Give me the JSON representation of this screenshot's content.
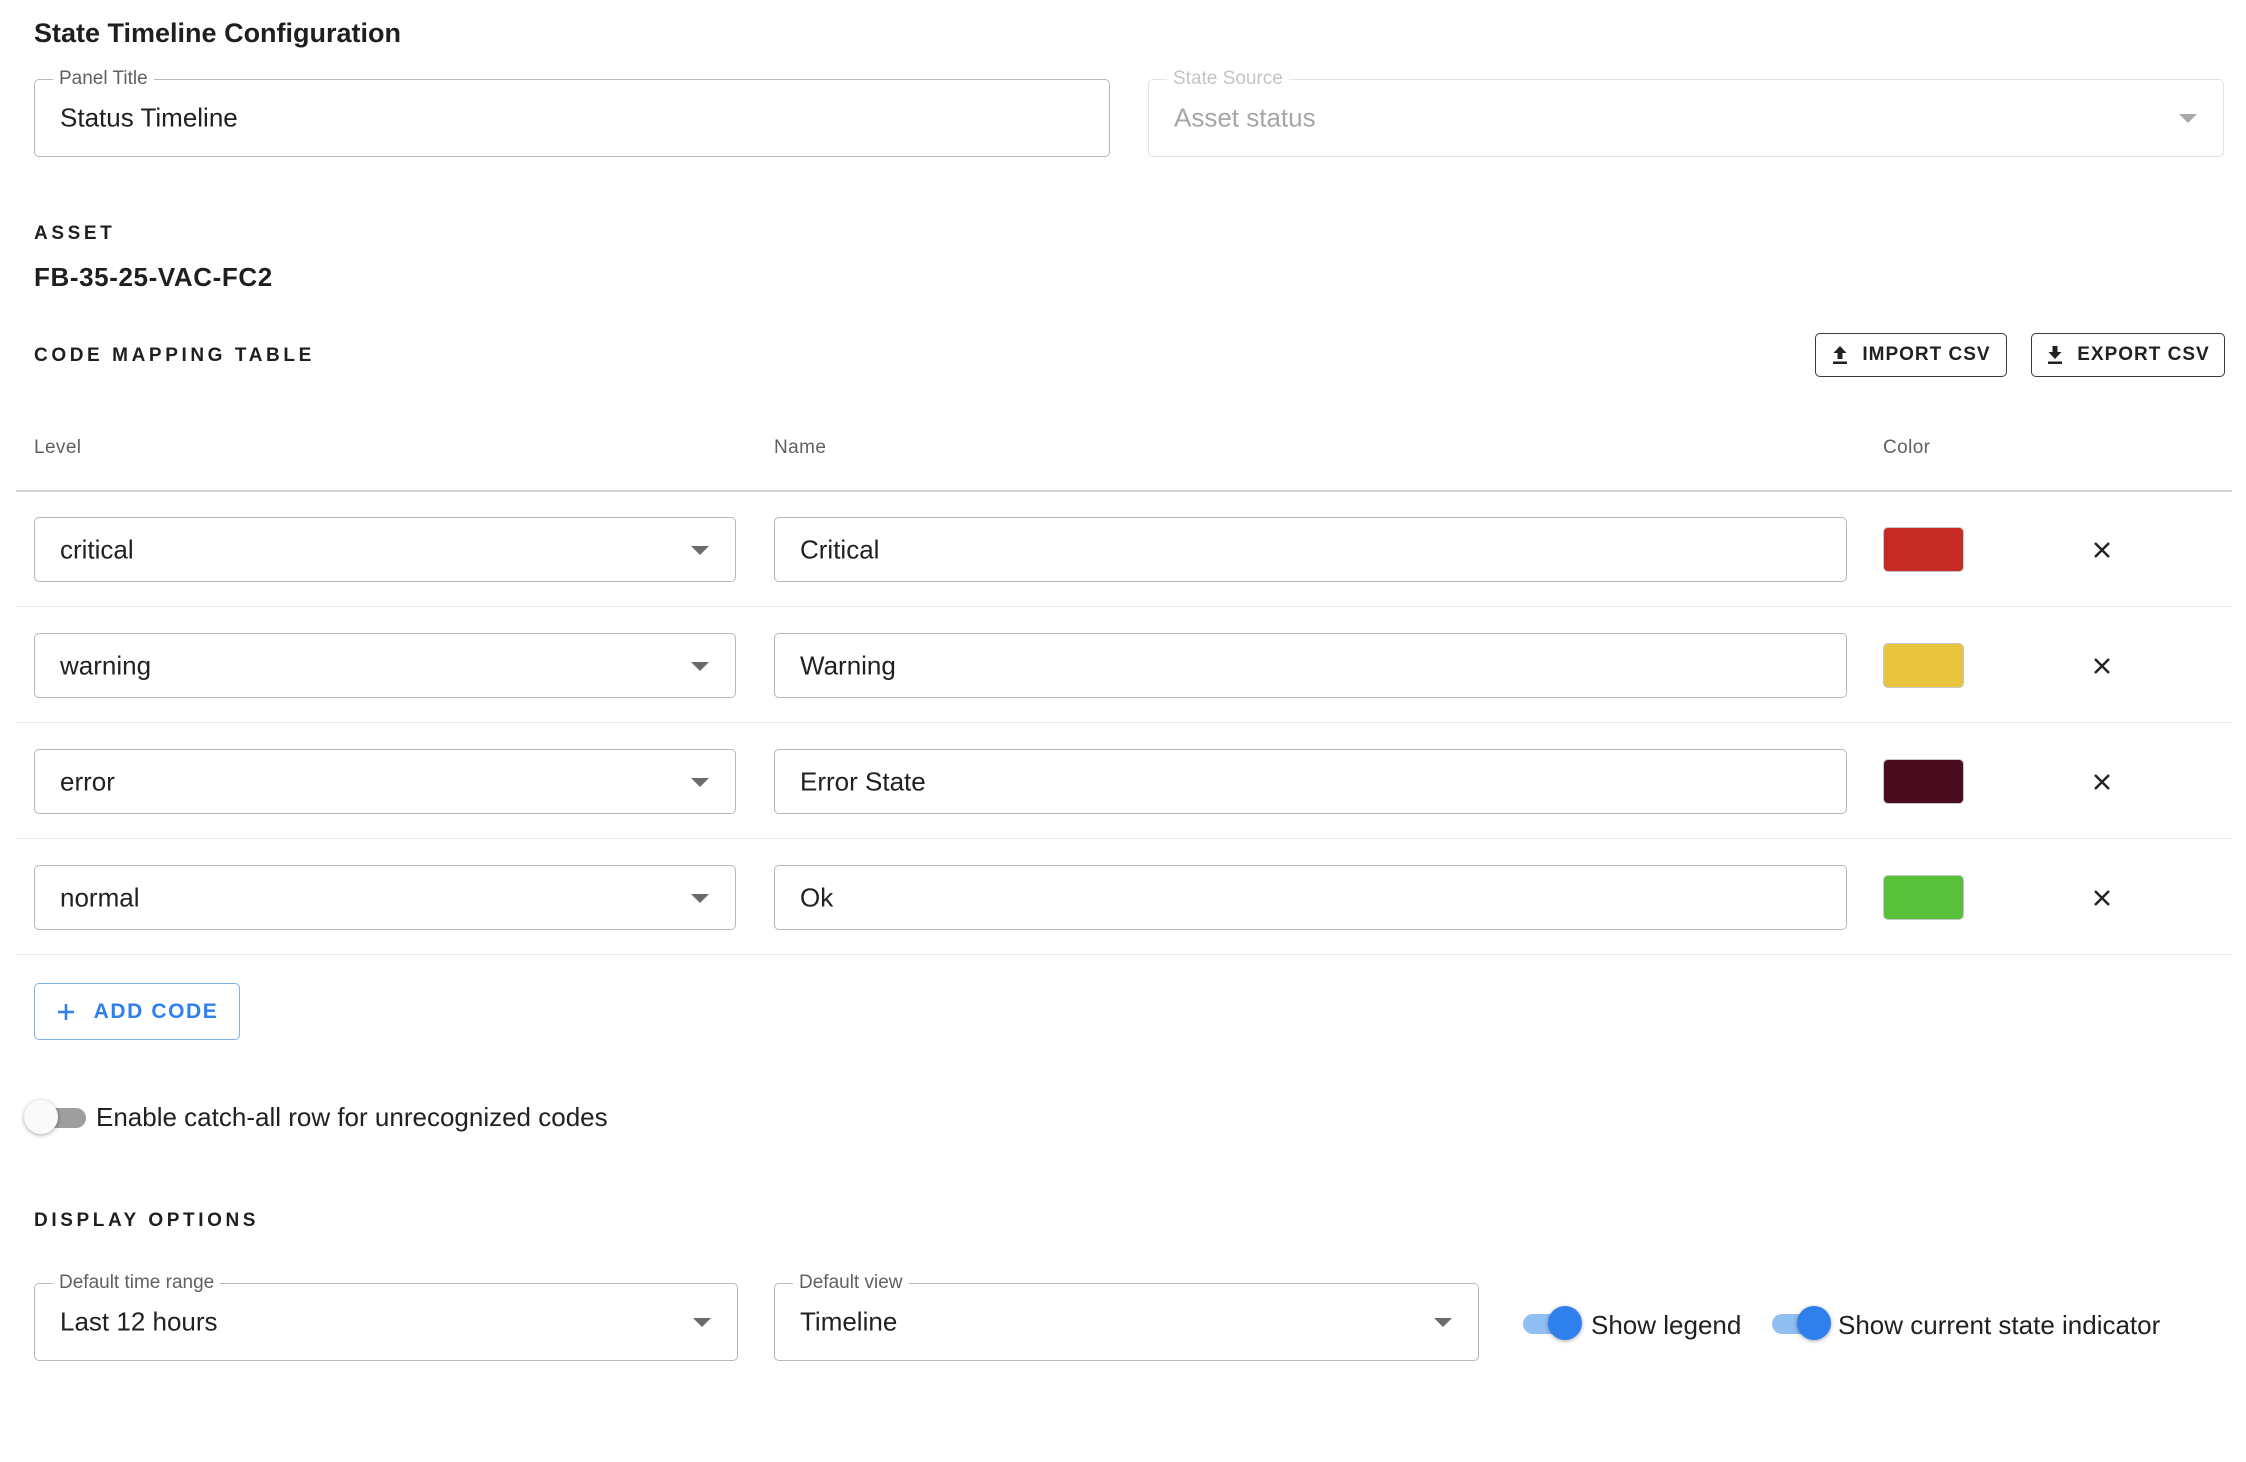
{
  "page": {
    "title": "State Timeline Configuration"
  },
  "panel_title": {
    "label": "Panel Title",
    "value": "Status Timeline"
  },
  "state_source": {
    "label": "State Source",
    "value": "Asset status",
    "disabled": true
  },
  "asset": {
    "section_label": "ASSET",
    "id": "FB-35-25-VAC-FC2"
  },
  "code_mapping": {
    "section_label": "CODE MAPPING TABLE",
    "import_label": "IMPORT CSV",
    "export_label": "EXPORT CSV",
    "columns": {
      "level": "Level",
      "name": "Name",
      "color": "Color"
    },
    "rows": [
      {
        "level": "critical",
        "name": "Critical",
        "color": "#c52b24"
      },
      {
        "level": "warning",
        "name": "Warning",
        "color": "#e8c43f"
      },
      {
        "level": "error",
        "name": "Error State",
        "color": "#4b0c1f"
      },
      {
        "level": "normal",
        "name": "Ok",
        "color": "#58c13a"
      }
    ],
    "add_label": "ADD CODE"
  },
  "catch_all": {
    "label": "Enable catch-all row for unrecognized codes",
    "enabled": false
  },
  "display_options": {
    "section_label": "DISPLAY OPTIONS",
    "time_range": {
      "label": "Default time range",
      "value": "Last 12 hours"
    },
    "default_view": {
      "label": "Default view",
      "value": "Timeline"
    },
    "show_legend": {
      "label": "Show legend",
      "enabled": true
    },
    "show_current_state": {
      "label": "Show current state indicator",
      "enabled": true
    }
  },
  "colors": {
    "accent": "#2f80ed",
    "accent_track": "#90bff3"
  },
  "icons": {
    "dropdown": "arrow-drop-down-icon",
    "import": "upload-icon",
    "export": "download-icon",
    "remove": "close-icon",
    "add": "plus-icon"
  }
}
